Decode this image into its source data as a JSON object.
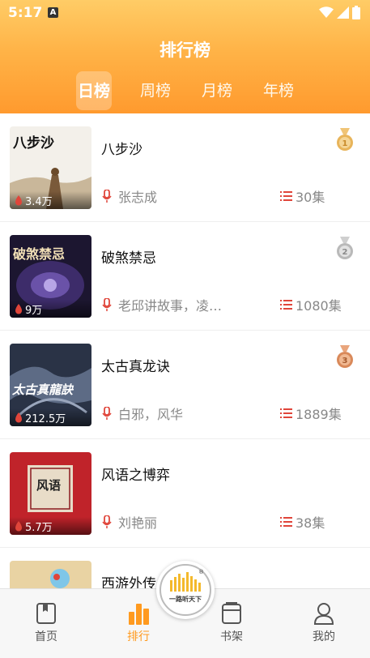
{
  "status": {
    "time": "5:17",
    "indicator": "A"
  },
  "header": {
    "title": "排行榜"
  },
  "tabs": [
    {
      "label": "日榜",
      "active": true
    },
    {
      "label": "周榜",
      "active": false
    },
    {
      "label": "月榜",
      "active": false
    },
    {
      "label": "年榜",
      "active": false
    }
  ],
  "books": [
    {
      "title": "八步沙",
      "author": "张志成",
      "episodes": "30集",
      "plays": "3.4万",
      "rank_icon": "gold-medal-1-icon",
      "cover_text": "八步沙"
    },
    {
      "title": "破煞禁忌",
      "author": "老邱讲故事，凌…",
      "episodes": "1080集",
      "plays": "9万",
      "rank_icon": "silver-medal-2-icon",
      "cover_text": "破煞禁忌"
    },
    {
      "title": "太古真龙诀",
      "author": "白邪，风华",
      "episodes": "1889集",
      "plays": "212.5万",
      "rank_icon": "bronze-medal-3-icon",
      "cover_text": "太古真龍訣"
    },
    {
      "title": "风语之博弈",
      "author": "刘艳丽",
      "episodes": "38集",
      "plays": "5.7万",
      "rank_icon": null,
      "cover_text": "风语"
    },
    {
      "title": "西游外传",
      "author": "",
      "episodes": "",
      "plays": "",
      "rank_icon": null,
      "cover_text": ""
    }
  ],
  "nav": [
    {
      "label": "首页",
      "icon": "book-home-icon",
      "active": false
    },
    {
      "label": "排行",
      "icon": "bar-chart-icon",
      "active": true
    },
    {
      "label": "书架",
      "icon": "bookshelf-icon",
      "active": false
    },
    {
      "label": "我的",
      "icon": "user-profile-icon",
      "active": false
    }
  ],
  "logo": {
    "text": "一路听天下",
    "mark": "®"
  },
  "colors": {
    "accent": "#ff9a1f",
    "header_top": "#ffcc66",
    "header_bottom": "#ff9a2e",
    "icon_red": "#e0453a",
    "gold": "#e8b45a",
    "silver": "#b9b9b9",
    "bronze": "#d9895a"
  }
}
